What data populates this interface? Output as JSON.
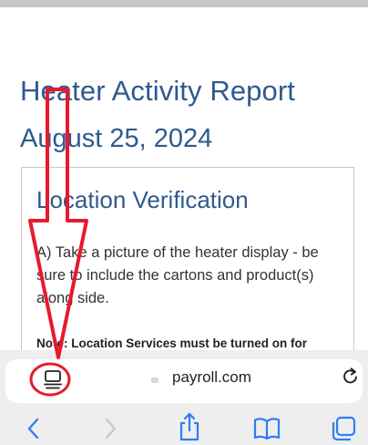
{
  "page": {
    "title": "Heater Activity Report",
    "date": "August 25, 2024"
  },
  "card": {
    "heading": "Location Verification",
    "instruction": "A) Take a picture of the heater display - be sure to include the cartons and product(s) along side.",
    "note": "Note: Location Services must be turned on for"
  },
  "browser": {
    "url": "payroll.com",
    "icons": {
      "tab_view": "tab-view-icon",
      "reload": "reload-icon",
      "back": "chevron-left-icon",
      "forward": "chevron-right-icon",
      "share": "share-icon",
      "bookmarks": "book-icon",
      "tabs": "tabs-icon"
    },
    "accent": "#2f7df6"
  },
  "colors": {
    "heading": "#2f5a8e",
    "annotation": "#e8192c"
  }
}
